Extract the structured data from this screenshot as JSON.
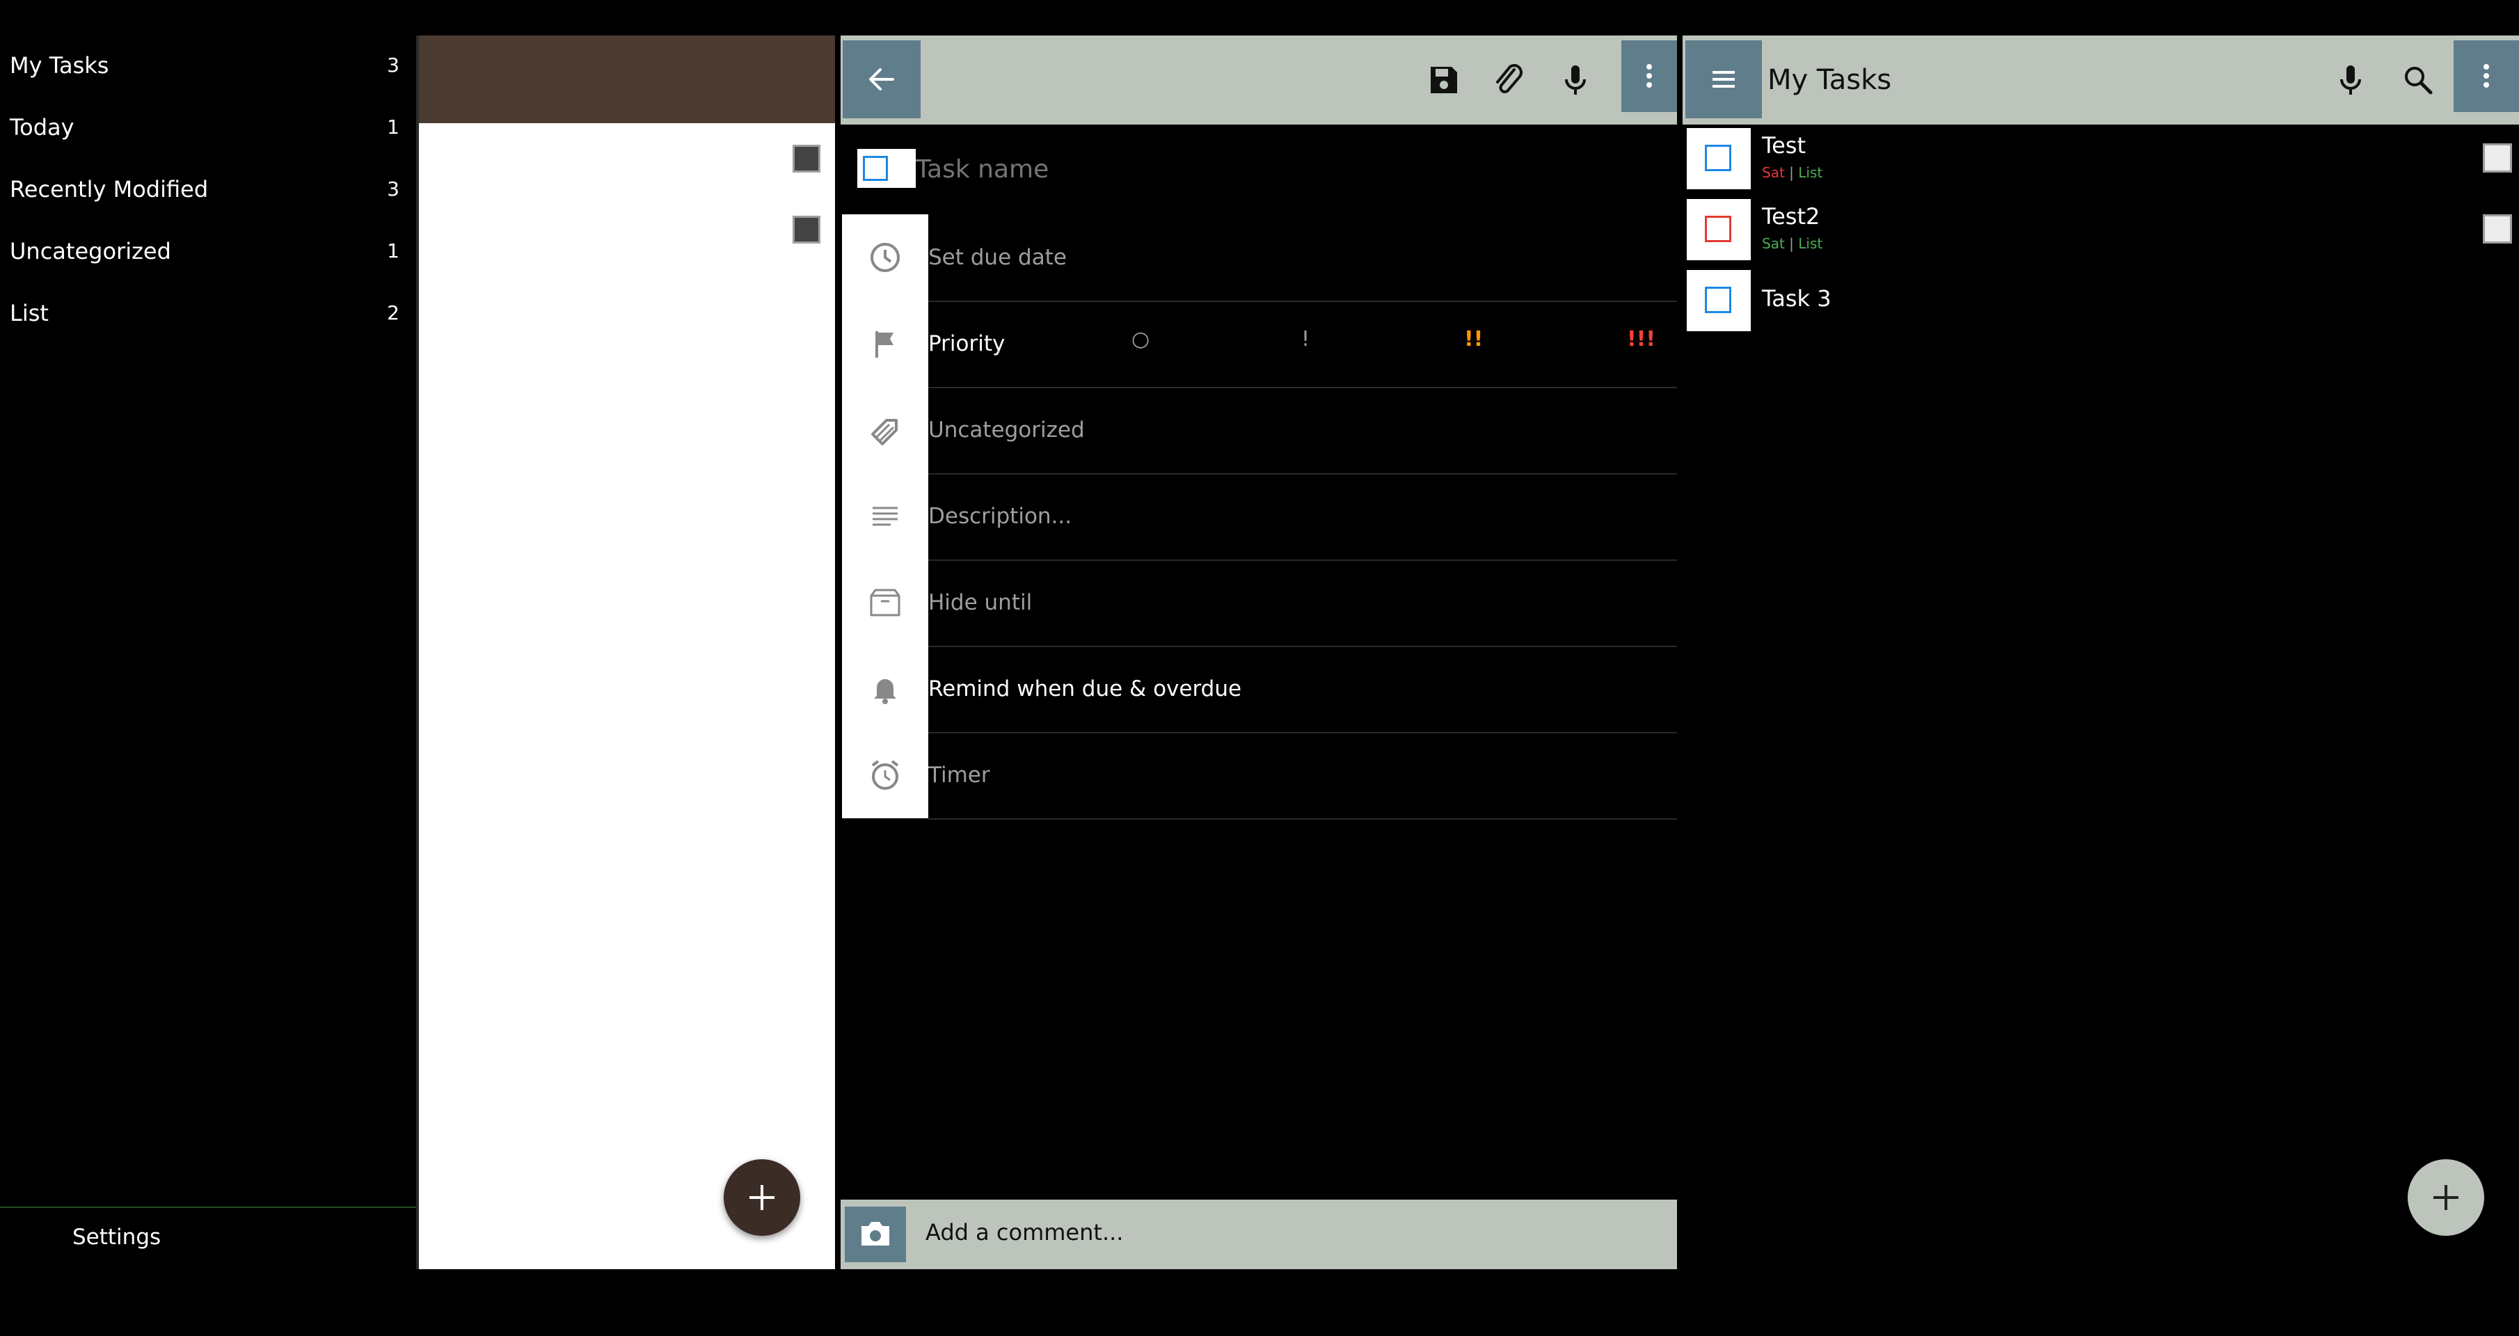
{
  "nav": {
    "items": [
      {
        "label": "My Tasks",
        "count": "3"
      },
      {
        "label": "Today",
        "count": "1"
      },
      {
        "label": "Recently Modified",
        "count": "3"
      },
      {
        "label": "Uncategorized",
        "count": "1"
      },
      {
        "label": "List",
        "count": "2"
      }
    ],
    "settings_label": "Settings"
  },
  "edit": {
    "title_placeholder": "Task name",
    "due_date": "Set due date",
    "priority_label": "Priority",
    "priority_options": [
      "○",
      "!",
      "!!",
      "!!!"
    ],
    "priority_colors": [
      "#9e9e9e",
      "#9e9e9e",
      "#ff9800",
      "#f44336"
    ],
    "category": "Uncategorized",
    "description_placeholder": "Description...",
    "hide_until": "Hide until",
    "reminder": "Remind when due & overdue",
    "timer": "Timer",
    "comment_label": "Add a comment..."
  },
  "list": {
    "title": "My Tasks",
    "tasks": [
      {
        "title": "Test",
        "due": "Sat",
        "sep": "|",
        "list": "List",
        "due_color": "#e53935",
        "check_color": "blue"
      },
      {
        "title": "Test2",
        "due": "Sat",
        "sep": "|",
        "list": "List",
        "due_color": "#4caf50",
        "check_color": "red"
      },
      {
        "title": "Task 3",
        "due": "",
        "sep": "",
        "list": "",
        "due_color": "",
        "check_color": "blue"
      }
    ]
  },
  "colors": {
    "toolbar": "#bcc4bc",
    "icon_box": "#607d8b",
    "list_header": "#4b3a30",
    "accent_blue": "#1e88e5",
    "accent_red": "#e53935",
    "meta_green": "#4caf50"
  },
  "icons": [
    "back-arrow-icon",
    "save-icon",
    "attachment-icon",
    "microphone-icon",
    "more-vert-icon",
    "clock-icon",
    "flag-icon",
    "tag-icon",
    "notes-icon",
    "box-icon",
    "bell-icon",
    "alarm-icon",
    "camera-icon",
    "menu-icon",
    "search-icon",
    "add-icon"
  ]
}
